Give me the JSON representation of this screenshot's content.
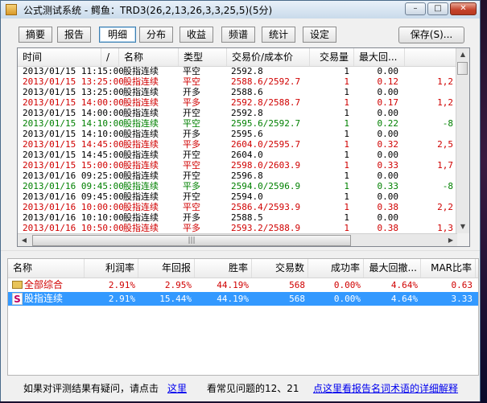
{
  "window": {
    "title": "公式测试系统 - 鳄鱼：TRD3(26,2,13,26,3,3,25,5)(5分)",
    "controls": [
      "–",
      "□",
      "✕"
    ]
  },
  "tabs": [
    {
      "label": "摘要"
    },
    {
      "label": "报告"
    },
    {
      "label": "明细",
      "active": true
    },
    {
      "label": "分布"
    },
    {
      "label": "收益"
    },
    {
      "label": "频谱"
    },
    {
      "label": "统计"
    },
    {
      "label": "设定"
    }
  ],
  "save_button": "保存(S)...",
  "trades": {
    "columns": [
      "时间",
      "/",
      "名称",
      "类型",
      "交易价/成本价",
      "交易量",
      "最大回..."
    ],
    "rows": [
      {
        "time": "2013/01/15 11:15:00",
        "name": "股指连续",
        "type": "平空",
        "price": "2592.8",
        "qty": "1",
        "max_dd": "0.00",
        "extra": "",
        "color": "black"
      },
      {
        "time": "2013/01/15 13:25:00",
        "name": "股指连续",
        "type": "平空",
        "price": "2588.6/2592.7",
        "qty": "1",
        "max_dd": "0.12",
        "extra": "1,2",
        "color": "red"
      },
      {
        "time": "2013/01/15 13:25:00",
        "name": "股指连续",
        "type": "开多",
        "price": "2588.6",
        "qty": "1",
        "max_dd": "0.00",
        "extra": "",
        "color": "black"
      },
      {
        "time": "2013/01/15 14:00:00",
        "name": "股指连续",
        "type": "平多",
        "price": "2592.8/2588.7",
        "qty": "1",
        "max_dd": "0.17",
        "extra": "1,2",
        "color": "red"
      },
      {
        "time": "2013/01/15 14:00:00",
        "name": "股指连续",
        "type": "开空",
        "price": "2592.8",
        "qty": "1",
        "max_dd": "0.00",
        "extra": "",
        "color": "black"
      },
      {
        "time": "2013/01/15 14:10:00",
        "name": "股指连续",
        "type": "平空",
        "price": "2595.6/2592.7",
        "qty": "1",
        "max_dd": "0.22",
        "extra": "-8",
        "color": "green"
      },
      {
        "time": "2013/01/15 14:10:00",
        "name": "股指连续",
        "type": "开多",
        "price": "2595.6",
        "qty": "1",
        "max_dd": "0.00",
        "extra": "",
        "color": "black"
      },
      {
        "time": "2013/01/15 14:45:00",
        "name": "股指连续",
        "type": "平多",
        "price": "2604.0/2595.7",
        "qty": "1",
        "max_dd": "0.32",
        "extra": "2,5",
        "color": "red"
      },
      {
        "time": "2013/01/15 14:45:00",
        "name": "股指连续",
        "type": "开空",
        "price": "2604.0",
        "qty": "1",
        "max_dd": "0.00",
        "extra": "",
        "color": "black"
      },
      {
        "time": "2013/01/15 15:00:00",
        "name": "股指连续",
        "type": "平空",
        "price": "2598.0/2603.9",
        "qty": "1",
        "max_dd": "0.33",
        "extra": "1,7",
        "color": "red"
      },
      {
        "time": "2013/01/16 09:25:00",
        "name": "股指连续",
        "type": "开空",
        "price": "2596.8",
        "qty": "1",
        "max_dd": "0.00",
        "extra": "",
        "color": "black"
      },
      {
        "time": "2013/01/16 09:45:00",
        "name": "股指连续",
        "type": "平多",
        "price": "2594.0/2596.9",
        "qty": "1",
        "max_dd": "0.33",
        "extra": "-8",
        "color": "green"
      },
      {
        "time": "2013/01/16 09:45:00",
        "name": "股指连续",
        "type": "开空",
        "price": "2594.0",
        "qty": "1",
        "max_dd": "0.00",
        "extra": "",
        "color": "black"
      },
      {
        "time": "2013/01/16 10:00:00",
        "name": "股指连续",
        "type": "平空",
        "price": "2586.4/2593.9",
        "qty": "1",
        "max_dd": "0.38",
        "extra": "2,2",
        "color": "red"
      },
      {
        "time": "2013/01/16 10:10:00",
        "name": "股指连续",
        "type": "开多",
        "price": "2588.5",
        "qty": "1",
        "max_dd": "0.00",
        "extra": "",
        "color": "black"
      },
      {
        "time": "2013/01/16 10:50:00",
        "name": "股指连续",
        "type": "平多",
        "price": "2593.2/2588.9",
        "qty": "1",
        "max_dd": "0.38",
        "extra": "1,3",
        "color": "red"
      }
    ]
  },
  "summary": {
    "columns": [
      "名称",
      "利润率",
      "年回报",
      "胜率",
      "交易数",
      "成功率",
      "最大回撤...",
      "MAR比率"
    ],
    "rows": [
      {
        "name": "全部综合",
        "profit": "2.91%",
        "annual": "2.95%",
        "win": "44.19%",
        "trades": "568",
        "success": "0.00%",
        "max_dd": "4.64%",
        "mar": "0.63",
        "selected": false,
        "icon": "folder-icon"
      },
      {
        "name": "股指连续",
        "profit": "2.91%",
        "annual": "15.44%",
        "win": "44.19%",
        "trades": "568",
        "success": "0.00%",
        "max_dd": "4.64%",
        "mar": "3.33",
        "selected": true,
        "icon": "s-icon"
      }
    ]
  },
  "footer": {
    "prefix": "如果对评测结果有疑问，请点击",
    "link1": "这里",
    "middle": "看常见问题的12、21",
    "link2": "点这里看报告名词术语的详细解释"
  },
  "colors": {
    "red": "#d00000",
    "green": "#008000",
    "black": "#000000",
    "selection": "#3399ff"
  }
}
